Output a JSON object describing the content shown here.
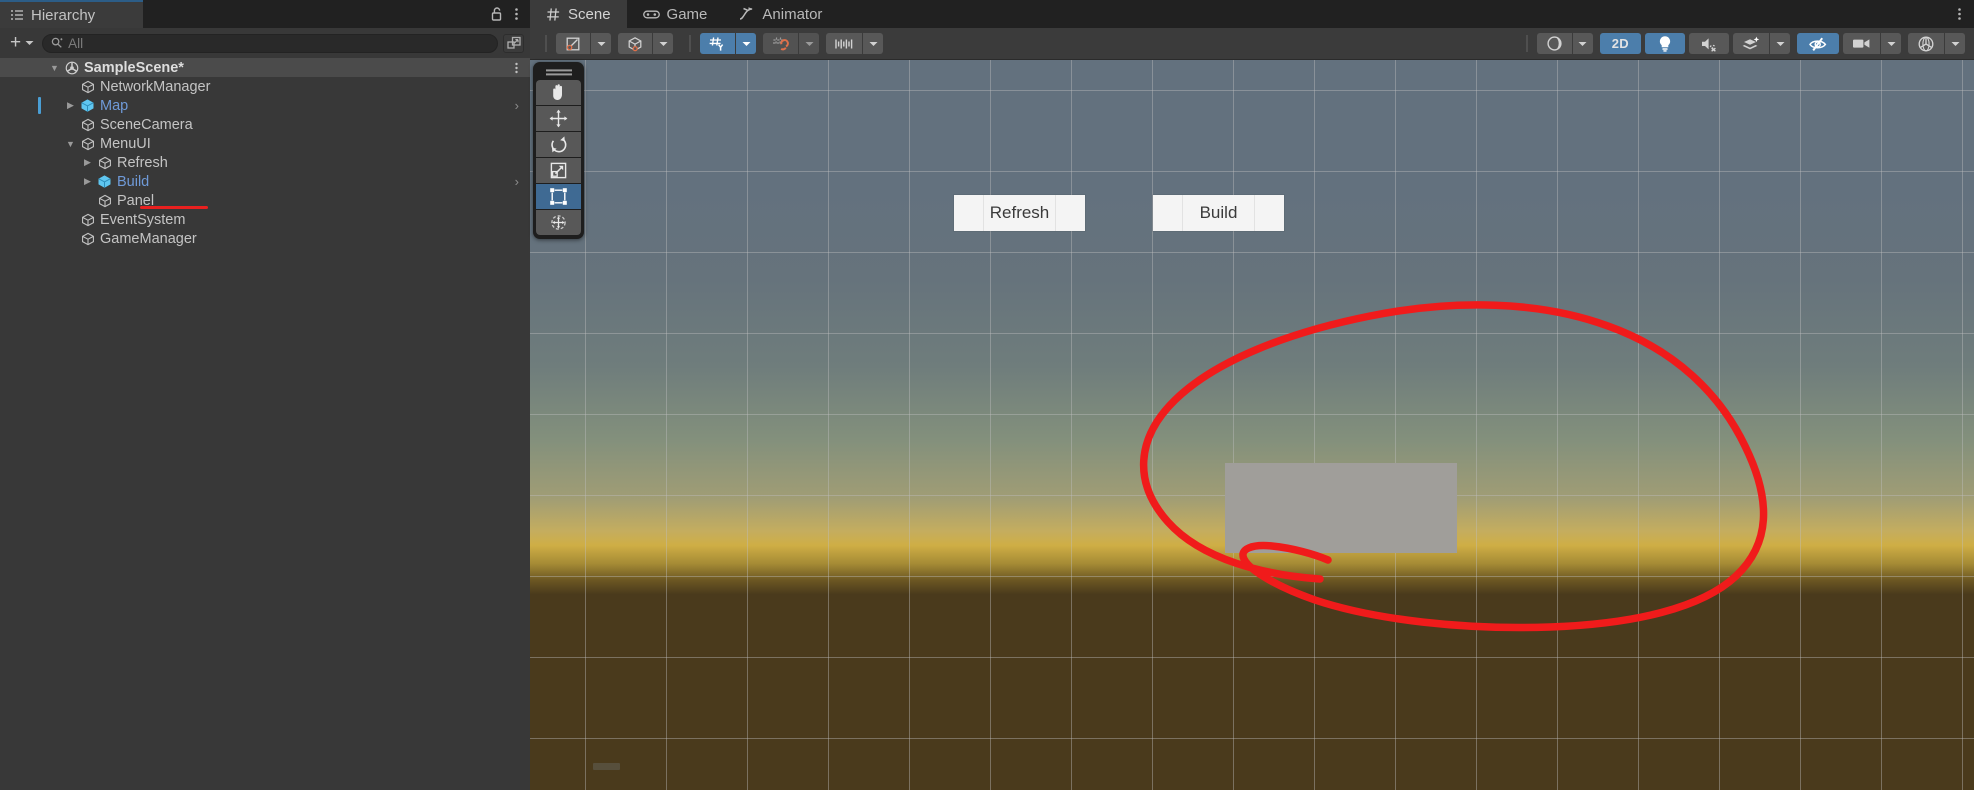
{
  "hierarchy_panel": {
    "tab": {
      "label": "Hierarchy",
      "icon": "list-icon"
    },
    "lock_icon": "lock-open-icon",
    "menu_icon": "kebab-menu-icon",
    "toolbar": {
      "add_label": "+",
      "add_dropdown_icon": "chevron-down-icon",
      "search_icon": "search-icon",
      "search_placeholder": "All",
      "search_value": "",
      "expand_panel_icon": "open-in-new-icon"
    },
    "tree": [
      {
        "name": "SampleScene*",
        "depth": 0,
        "icon": "unity-scene-icon",
        "twisty": "down",
        "selected_row": true,
        "prefab": false,
        "kebab": true,
        "chevron": false
      },
      {
        "name": "NetworkManager",
        "depth": 1,
        "icon": "gameobject-icon",
        "twisty": "none",
        "selected_row": false,
        "prefab": false,
        "kebab": false,
        "chevron": false
      },
      {
        "name": "Map",
        "depth": 1,
        "icon": "prefab-icon",
        "twisty": "right",
        "selected_row": false,
        "prefab": true,
        "kebab": false,
        "chevron": true,
        "selbar": true
      },
      {
        "name": "SceneCamera",
        "depth": 1,
        "icon": "gameobject-icon",
        "twisty": "none",
        "selected_row": false,
        "prefab": false,
        "kebab": false,
        "chevron": false
      },
      {
        "name": "MenuUI",
        "depth": 1,
        "icon": "gameobject-icon",
        "twisty": "down",
        "selected_row": false,
        "prefab": false,
        "kebab": false,
        "chevron": false
      },
      {
        "name": "Refresh",
        "depth": 2,
        "icon": "gameobject-icon",
        "twisty": "right",
        "selected_row": false,
        "prefab": false,
        "kebab": false,
        "chevron": false
      },
      {
        "name": "Build",
        "depth": 2,
        "icon": "prefab-icon",
        "twisty": "right",
        "selected_row": false,
        "prefab": true,
        "kebab": false,
        "chevron": true
      },
      {
        "name": "Panel",
        "depth": 2,
        "icon": "gameobject-icon",
        "twisty": "none",
        "selected_row": false,
        "prefab": false,
        "kebab": false,
        "chevron": false,
        "underlined": true
      },
      {
        "name": "EventSystem",
        "depth": 1,
        "icon": "gameobject-icon",
        "twisty": "none",
        "selected_row": false,
        "prefab": false,
        "kebab": false,
        "chevron": false
      },
      {
        "name": "GameManager",
        "depth": 1,
        "icon": "gameobject-icon",
        "twisty": "none",
        "selected_row": false,
        "prefab": false,
        "kebab": false,
        "chevron": false
      }
    ]
  },
  "scene_panel": {
    "tabs": [
      {
        "label": "Scene",
        "icon": "grid-hash-icon",
        "active": true
      },
      {
        "label": "Game",
        "icon": "gamepad-icon",
        "active": false
      },
      {
        "label": "Animator",
        "icon": "animator-arrow-icon",
        "active": false
      }
    ],
    "menu_icon": "kebab-menu-icon",
    "toolbar_left": [
      {
        "name": "pivot-toggle",
        "icon": "pivot-center-icon",
        "active": false
      },
      {
        "name": "pivot-dropdown",
        "icon": "chevron-down-icon",
        "active": false
      },
      {
        "name": "handle-space-toggle",
        "icon": "global-local-cube-icon",
        "active": false
      },
      {
        "name": "handle-space-dropdown",
        "icon": "chevron-down-icon",
        "active": false
      },
      {
        "name": "grid-axis-toggle",
        "icon": "grid-y-axis-icon",
        "active": true
      },
      {
        "name": "grid-axis-dropdown",
        "icon": "chevron-down-icon",
        "active": true
      },
      {
        "name": "grid-snapping-toggle",
        "icon": "grid-magnet-icon",
        "active": false
      },
      {
        "name": "grid-snapping-dropdown",
        "icon": "chevron-down-icon",
        "active": false
      },
      {
        "name": "grid-size-toggle",
        "icon": "ruler-icon",
        "active": false
      },
      {
        "name": "grid-size-dropdown",
        "icon": "chevron-down-icon",
        "active": false
      }
    ],
    "toolbar_right": [
      {
        "name": "shading-mode",
        "icon": "shaded-sphere-icon",
        "active": false
      },
      {
        "name": "shading-mode-dropdown",
        "icon": "chevron-down-icon",
        "active": false
      },
      {
        "name": "2d-toggle",
        "label": "2D",
        "icon": "",
        "active": true
      },
      {
        "name": "scene-lighting-toggle",
        "icon": "lightbulb-icon",
        "active": true
      },
      {
        "name": "scene-audio-toggle",
        "icon": "speaker-muted-icon",
        "active": false
      },
      {
        "name": "scene-fx-toggle",
        "icon": "layers-sparkle-icon",
        "active": false
      },
      {
        "name": "scene-fx-dropdown",
        "icon": "chevron-down-icon",
        "active": false
      },
      {
        "name": "scene-visibility-toggle",
        "icon": "eye-hidden-icon",
        "active": true
      },
      {
        "name": "camera-settings",
        "icon": "camera-icon",
        "active": false
      },
      {
        "name": "camera-settings-dropdown",
        "icon": "chevron-down-icon",
        "active": false
      },
      {
        "name": "gizmos-toggle",
        "icon": "gizmos-globe-icon",
        "active": false
      },
      {
        "name": "gizmos-dropdown",
        "icon": "chevron-down-icon",
        "active": false
      }
    ],
    "tool_palette": [
      {
        "name": "hand-tool",
        "icon": "hand-icon",
        "selected": false
      },
      {
        "name": "move-tool",
        "icon": "move-arrows-icon",
        "selected": false
      },
      {
        "name": "rotate-tool",
        "icon": "rotate-icon",
        "selected": false
      },
      {
        "name": "scale-tool",
        "icon": "scale-icon",
        "selected": false
      },
      {
        "name": "rect-tool",
        "icon": "rect-transform-icon",
        "selected": true
      },
      {
        "name": "transform-tool",
        "icon": "transform-combined-icon",
        "selected": false
      }
    ],
    "scene_objects": {
      "refresh_button_label": "Refresh",
      "build_button_label": "Build",
      "panel_rect_color": "#a09e9a"
    },
    "annotation": {
      "color": "#f01b1b",
      "shape": "hand-drawn-circle"
    }
  },
  "colors": {
    "accent_blue": "#4c7eab",
    "selection_blue": "#4a9ed4",
    "prefab_text": "#6f9ad8",
    "annotation_red": "#f01b1b",
    "panel_bg": "#383838",
    "tabbar_bg": "#212121"
  }
}
